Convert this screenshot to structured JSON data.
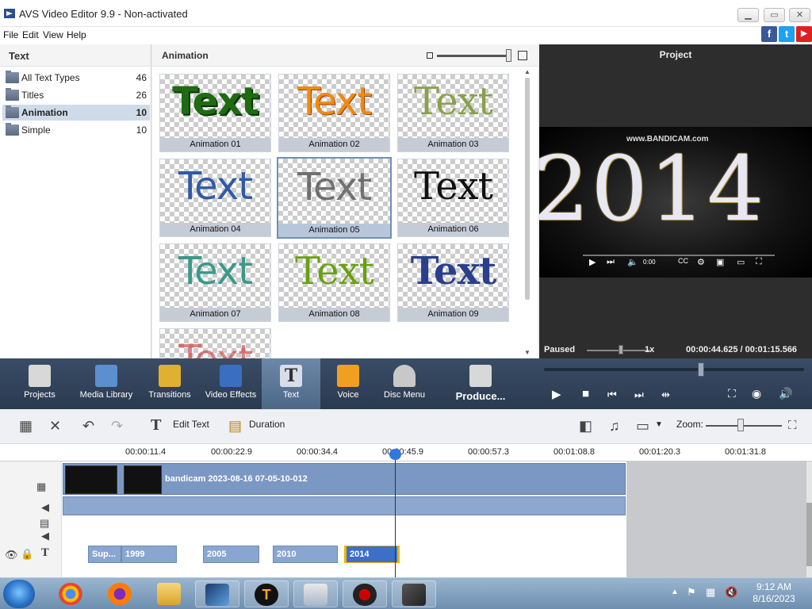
{
  "window": {
    "title": "AVS Video Editor 9.9 - Non-activated",
    "controls": [
      "▁",
      "▭",
      "✕"
    ]
  },
  "menu": [
    "File",
    "Edit",
    "View",
    "Help"
  ],
  "social": [
    {
      "name": "facebook",
      "glyph": "f",
      "color": "#3b5998"
    },
    {
      "name": "twitter",
      "glyph": "t",
      "color": "#1da1f2"
    },
    {
      "name": "youtube",
      "glyph": "▶",
      "color": "#e02020"
    }
  ],
  "categories": {
    "title": "Text",
    "items": [
      {
        "label": "All Text Types",
        "count": "46",
        "selected": false
      },
      {
        "label": "Titles",
        "count": "26",
        "selected": false
      },
      {
        "label": "Animation",
        "count": "10",
        "selected": true
      },
      {
        "label": "Simple",
        "count": "10",
        "selected": false
      }
    ]
  },
  "animation_panel": {
    "title": "Animation",
    "tiles": [
      {
        "caption": "Animation 01",
        "sample": "Text",
        "color": "#1f6b12"
      },
      {
        "caption": "Animation 02",
        "sample": "Text",
        "color": "#e07a10"
      },
      {
        "caption": "Animation 03",
        "sample": "Text",
        "color": "#8aa04a"
      },
      {
        "caption": "Animation 04",
        "sample": "Text",
        "color": "#2f5aa8"
      },
      {
        "caption": "Animation 05",
        "sample": "Text",
        "color": "#5c5c5c"
      },
      {
        "caption": "Animation 06",
        "sample": "Text",
        "color": "#111111"
      },
      {
        "caption": "Animation 07",
        "sample": "Text",
        "color": "#3a9a8a"
      },
      {
        "caption": "Animation 08",
        "sample": "Text",
        "color": "#6aa010"
      },
      {
        "caption": "Animation 09",
        "sample": "Text",
        "color": "#2a3f8c"
      },
      {
        "caption": "",
        "sample": "Text",
        "color": "#cc3030"
      }
    ],
    "selected_index": 4
  },
  "preview": {
    "title": "Project",
    "watermark": "www.BANDICAM.com",
    "frame_text": "2014",
    "player_time": "0:00",
    "status": "Paused",
    "speed": "1x",
    "time": "00:00:44.625 / 00:01:15.566"
  },
  "tools": [
    {
      "label": "Projects",
      "icon": "clapper-icon",
      "color": "#d8d8d8"
    },
    {
      "label": "Media Library",
      "icon": "film-icon",
      "color": "#5b8fd0"
    },
    {
      "label": "Transitions",
      "icon": "transitions-icon",
      "color": "#e0b030"
    },
    {
      "label": "Video Effects",
      "icon": "star-icon",
      "color": "#3a6fc0"
    },
    {
      "label": "Text",
      "icon": "text-icon",
      "color": "#d8dee8"
    },
    {
      "label": "Voice",
      "icon": "microphone-icon",
      "color": "#f0a020"
    },
    {
      "label": "Disc Menu",
      "icon": "disc-icon",
      "color": "#c8c8c8"
    },
    {
      "label": "Produce...",
      "icon": "produce-icon",
      "color": "#d8d8d8"
    }
  ],
  "timeline_toolbar": {
    "edit_text": "Edit Text",
    "duration": "Duration",
    "zoom": "Zoom:"
  },
  "ruler": [
    "00:00:11.4",
    "00:00:22.9",
    "00:00:34.4",
    "00:00:45.9",
    "00:00:57.3",
    "00:01:08.8",
    "00:01:20.3",
    "00:01:31.8"
  ],
  "video_clip": {
    "name": "bandicam 2023-08-16 07-05-10-012"
  },
  "text_clips": [
    "Sup...",
    "1999",
    "2005",
    "2010",
    "2014"
  ],
  "taskbar": {
    "time": "9:12 AM",
    "date": "8/16/2023"
  }
}
